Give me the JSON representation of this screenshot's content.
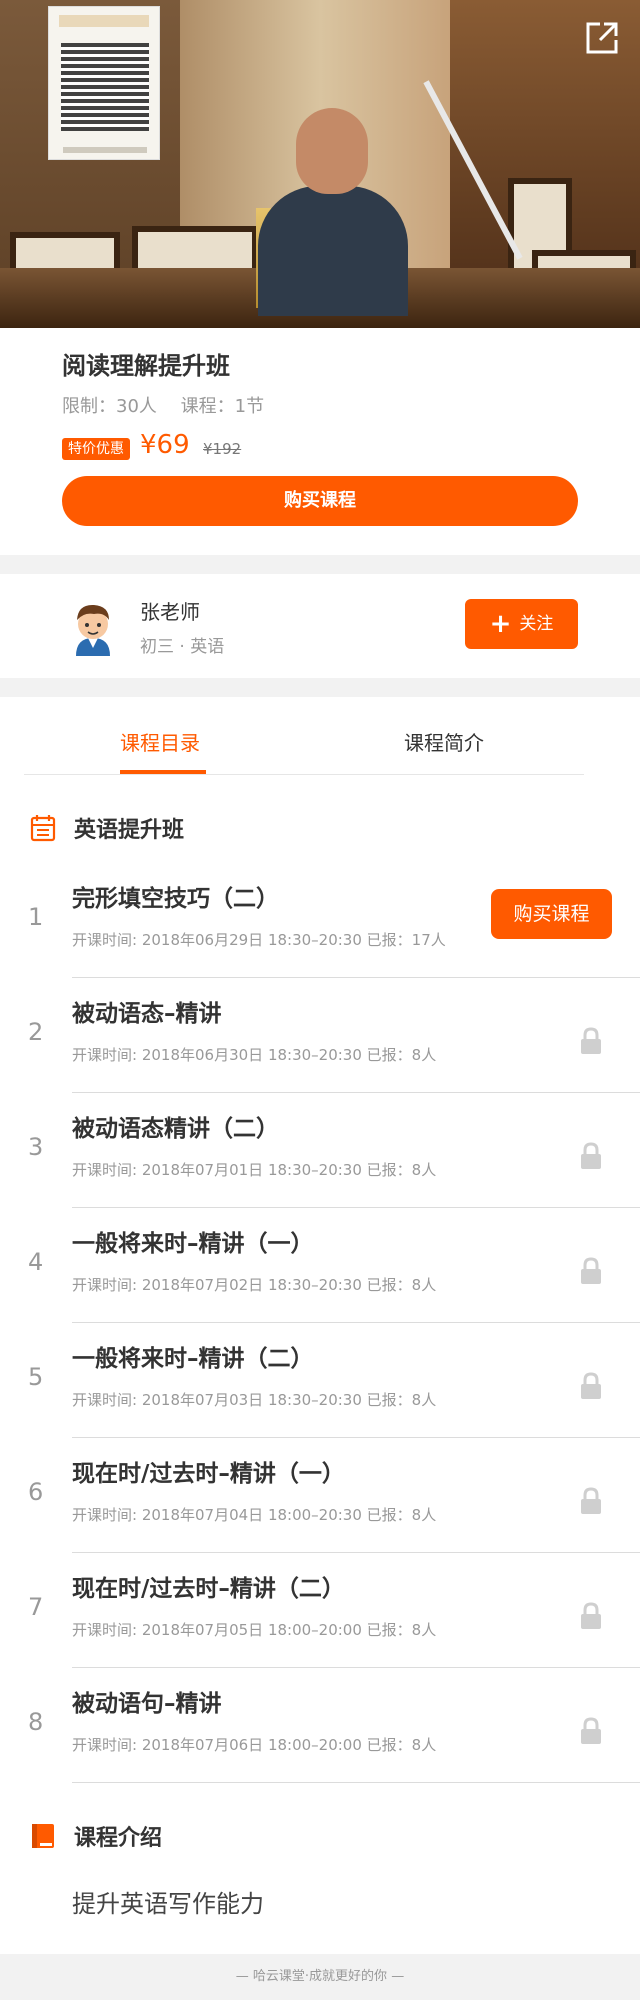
{
  "hero": {
    "share_icon": "share-external-icon",
    "qr_icon": "qr-code-icon"
  },
  "course": {
    "title": "阅读理解提升班",
    "limit": "限制：30人",
    "lessons_count": "课程：1节",
    "badge": "特价优惠",
    "price": "¥69",
    "original_price": "¥192",
    "buy_label": "购买课程"
  },
  "teacher": {
    "name": "张老师",
    "subtitle": "初三 · 英语",
    "follow_label": "关注",
    "avatar_icon": "cartoon-avatar-icon"
  },
  "tabs": [
    {
      "label": "课程目录",
      "active": true
    },
    {
      "label": "课程简介",
      "active": false
    }
  ],
  "catalog": {
    "title": "英语提升班",
    "icon": "calendar-icon",
    "lessons": [
      {
        "num": "1",
        "title": "完形填空技巧（二）",
        "detail": "开课时间: 2018年06月29日 18:30–20:30   已报：17人",
        "action": "购买课程"
      },
      {
        "num": "2",
        "title": "被动语态–精讲",
        "detail": "开课时间: 2018年06月30日 18:30–20:30   已报：8人"
      },
      {
        "num": "3",
        "title": "被动语态精讲（二）",
        "detail": "开课时间: 2018年07月01日 18:30–20:30   已报：8人"
      },
      {
        "num": "4",
        "title": "一般将来时–精讲（一）",
        "detail": "开课时间: 2018年07月02日 18:30–20:30   已报：8人"
      },
      {
        "num": "5",
        "title": "一般将来时–精讲（二）",
        "detail": "开课时间: 2018年07月03日 18:30–20:30   已报：8人"
      },
      {
        "num": "6",
        "title": "现在时/过去时–精讲（一）",
        "detail": "开课时间: 2018年07月04日 18:00–20:30   已报：8人"
      },
      {
        "num": "7",
        "title": "现在时/过去时–精讲（二）",
        "detail": "开课时间: 2018年07月05日 18:00–20:00   已报：8人"
      },
      {
        "num": "8",
        "title": "被动语句–精讲",
        "detail": "开课时间: 2018年07月06日 18:00–20:00   已报：8人"
      }
    ]
  },
  "intro": {
    "title": "课程介绍",
    "icon": "book-icon",
    "text": "提升英语写作能力"
  },
  "footer": {
    "text": "— 哈云课堂·成就更好的你 —"
  },
  "colors": {
    "accent": "#ff5a00",
    "text": "#333333",
    "muted": "#999999",
    "gap": "#f2f2f2"
  }
}
